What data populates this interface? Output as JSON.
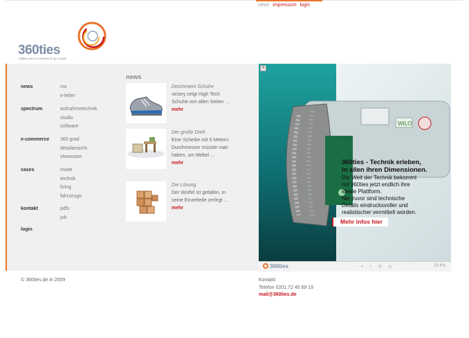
{
  "top_nav": {
    "news": "news",
    "impressum": "impressum",
    "login": "login"
  },
  "logo": {
    "name": "360ties",
    "tagline": "makes your e-commerce go round"
  },
  "sidebar": {
    "categories": [
      {
        "label": "news",
        "items": [
          "rss",
          "e-letter"
        ]
      },
      {
        "label": "spectrum",
        "items": [
          "aufnahmetechnik",
          "studio",
          "software"
        ]
      },
      {
        "label": "e-commerce",
        "items": [
          "360 grad",
          "detailansicht",
          "showcase"
        ]
      },
      {
        "label": "cases",
        "items": [
          "mode",
          "technik",
          "living",
          "fahrzeuge"
        ]
      },
      {
        "label": "kontakt",
        "items": [
          "pdfs",
          "job"
        ]
      },
      {
        "label": "login",
        "items": []
      }
    ]
  },
  "news": {
    "heading": "news",
    "items": [
      {
        "title": "Deichmann Schuhe",
        "line1": "victory zeigt High Tech",
        "line2": "Schuhe von allen Seiten ...",
        "line3": "",
        "more": "mehr",
        "thumb_icon": "shoe-icon"
      },
      {
        "title": "Der große Dreh",
        "line1": "Eine Scheibe mit 6 Metern",
        "line2": "Durchmesser müsste man",
        "line3": "haben, um Möbel ...",
        "more": "mehr",
        "thumb_icon": "furniture-icon"
      },
      {
        "title": "Die Lösung",
        "line1": "Der Würfel ist gefallen, in",
        "line2": "seine Einzelteile zerlegt ...",
        "line3": "",
        "more": "mehr",
        "thumb_icon": "wooden-cube-icon"
      }
    ]
  },
  "banner": {
    "headline_1": "360ties - Technik erleben,",
    "headline_2": "in allen ihren Dimensionen.",
    "body_1": "Die Welt der Technik bekommt",
    "body_2": "mit 360ties jetzt endlich ihre",
    "body_3": "ideale Plattform.",
    "body_4": "Nie zuvor sind technische",
    "body_5": "Details eindrucksvoller und",
    "body_6": "realistischer vermittelt worden.",
    "cta": "Mehr infos hier",
    "corner": "≡",
    "logo": "360ties",
    "controls": "- + ⌕ ✥ ⊞",
    "zoom": "19.4%",
    "product_label": "WILO"
  },
  "footer": {
    "copyright": "© 360ties.de in 2009",
    "contact_label": "Kontakt:",
    "phone": "Telefon 0201.72 45 69 19",
    "email": "mail@360ties.de"
  },
  "colors": {
    "accent_orange": "#e8742a",
    "link_red": "#c8171e",
    "logo_blue": "#7e8da6",
    "band_gray": "#f0f0f0"
  }
}
